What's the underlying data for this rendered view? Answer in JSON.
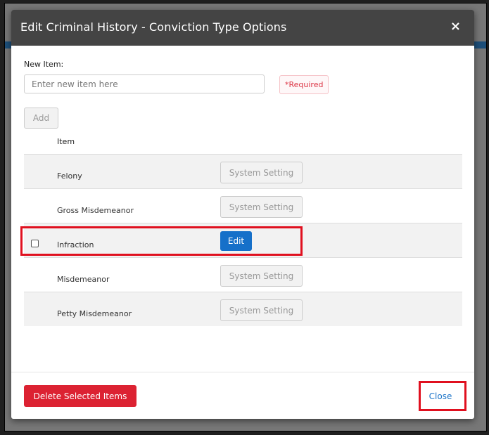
{
  "dialog": {
    "title": "Edit Criminal History - Conviction Type Options",
    "close_icon": "×"
  },
  "form": {
    "new_item_label": "New Item:",
    "new_item_placeholder": "Enter new item here",
    "required_badge": "*Required",
    "add_label": "Add"
  },
  "table": {
    "column_item": "Item",
    "rows": [
      {
        "name": "Felony",
        "action": "System Setting"
      },
      {
        "name": "Gross Misdemeanor",
        "action": "System Setting"
      },
      {
        "name": "Infraction",
        "action": "Edit"
      },
      {
        "name": "Misdemeanor",
        "action": "System Setting"
      },
      {
        "name": "Petty Misdemeanor",
        "action": "System Setting"
      }
    ]
  },
  "footer": {
    "delete_label": "Delete Selected Items",
    "close_label": "Close"
  },
  "colors": {
    "header_bg": "#444444",
    "primary": "#1670c9",
    "danger": "#dc2232",
    "highlight": "#e0101f"
  }
}
